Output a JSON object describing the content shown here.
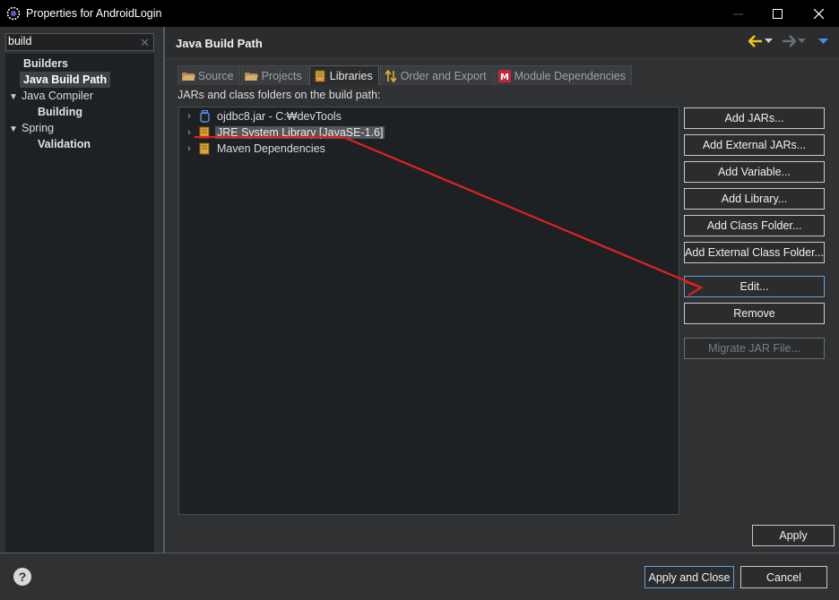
{
  "window": {
    "title": "Properties for AndroidLogin",
    "controls": [
      "minimize-icon",
      "maximize-icon",
      "close-icon"
    ]
  },
  "filter": {
    "value": "build"
  },
  "nav_tree": [
    {
      "label": "Builders",
      "bold": true
    },
    {
      "label": "Java Build Path",
      "bold": true,
      "selected": true
    },
    {
      "label": "Java Compiler",
      "expanded": true
    },
    {
      "label": "Building",
      "bold": true
    },
    {
      "label": "Spring",
      "expanded": true
    },
    {
      "label": "Validation",
      "bold": true
    }
  ],
  "page": {
    "title": "Java Build Path",
    "tabs": [
      {
        "label": "Source",
        "icon": "folder-icon"
      },
      {
        "label": "Projects",
        "icon": "folder-icon"
      },
      {
        "label": "Libraries",
        "icon": "library-icon",
        "active": true
      },
      {
        "label": "Order and Export",
        "icon": "order-icon"
      },
      {
        "label": "Module Dependencies",
        "icon": "module-icon"
      }
    ],
    "path_label": "JARs and class folders on the build path:",
    "libraries": [
      {
        "label": "ojdbc8.jar - C:₩devTools",
        "icon": "jar-icon"
      },
      {
        "label": "JRE System Library [JavaSE-1.6]",
        "icon": "library-icon",
        "selected": true
      },
      {
        "label": "Maven Dependencies",
        "icon": "library-icon"
      }
    ],
    "buttons": {
      "add_jars": "Add JARs...",
      "add_external_jars": "Add External JARs...",
      "add_variable": "Add Variable...",
      "add_library": "Add Library...",
      "add_class_folder": "Add Class Folder...",
      "add_external_class_folder": "Add External Class Folder...",
      "edit": "Edit...",
      "remove": "Remove",
      "migrate": "Migrate JAR File..."
    },
    "apply": "Apply"
  },
  "footer": {
    "help": "?",
    "apply_and_close": "Apply and Close",
    "cancel": "Cancel"
  },
  "colors": {
    "background": "#2f3133",
    "titlebar": "#000000",
    "annotation_arrow": "#e02020",
    "nav_back": "#f0c020",
    "nav_dropdown": "#4a90e2"
  }
}
